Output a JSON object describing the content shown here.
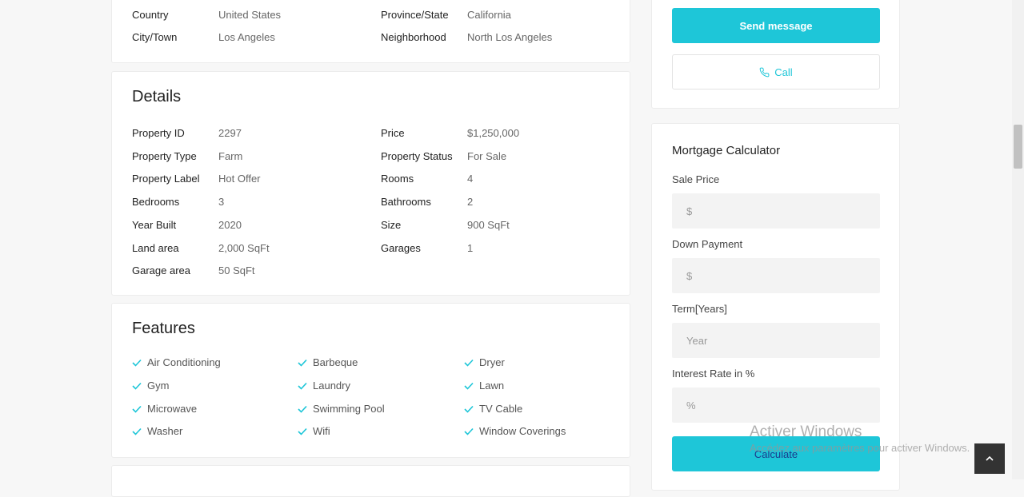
{
  "address": {
    "rows": [
      {
        "k1": "Country",
        "v1": "United States",
        "k2": "Province/State",
        "v2": "California"
      },
      {
        "k1": "City/Town",
        "v1": "Los Angeles",
        "k2": "Neighborhood",
        "v2": "North Los Angeles"
      }
    ]
  },
  "details": {
    "title": "Details",
    "rows": [
      {
        "k1": "Property ID",
        "v1": "2297",
        "k2": "Price",
        "v2": "$1,250,000"
      },
      {
        "k1": "Property Type",
        "v1": "Farm",
        "k2": "Property Status",
        "v2": "For Sale"
      },
      {
        "k1": "Property Label",
        "v1": "Hot Offer",
        "k2": "Rooms",
        "v2": "4"
      },
      {
        "k1": "Bedrooms",
        "v1": "3",
        "k2": "Bathrooms",
        "v2": "2"
      },
      {
        "k1": "Year Built",
        "v1": "2020",
        "k2": "Size",
        "v2": "900 SqFt"
      },
      {
        "k1": "Land area",
        "v1": "2,000 SqFt",
        "k2": "Garages",
        "v2": "1"
      },
      {
        "k1": "Garage area",
        "v1": "50 SqFt",
        "k2": "",
        "v2": ""
      }
    ]
  },
  "features": {
    "title": "Features",
    "items": [
      "Air Conditioning",
      "Barbeque",
      "Dryer",
      "Gym",
      "Laundry",
      "Lawn",
      "Microwave",
      "Swimming Pool",
      "TV Cable",
      "Washer",
      "Wifi",
      "Window Coverings"
    ]
  },
  "contact": {
    "send_label": "Send message",
    "call_label": "Call"
  },
  "mortgage": {
    "title": "Mortgage Calculator",
    "sale_price_label": "Sale Price",
    "sale_price_placeholder": "$",
    "down_payment_label": "Down Payment",
    "down_payment_placeholder": "$",
    "term_label": "Term[Years]",
    "term_placeholder": "Year",
    "interest_label": "Interest Rate in %",
    "interest_placeholder": "%",
    "calculate_label": "Calculate"
  },
  "watermark": {
    "title": "Activer Windows",
    "subtitle": "Accédez aux paramètres pour activer Windows."
  },
  "colors": {
    "accent": "#1ec6d8"
  },
  "icons": {
    "check": "check-icon",
    "phone": "phone-icon",
    "to_top": "chevron-up-icon"
  }
}
